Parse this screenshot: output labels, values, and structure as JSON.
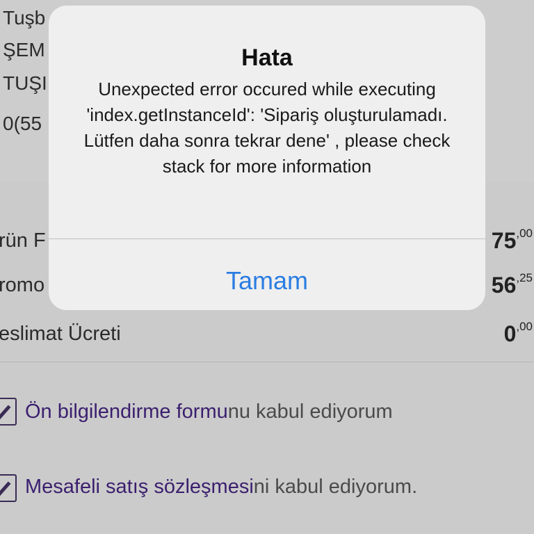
{
  "background": {
    "address_lines": [
      "Tuşb",
      "ŞEM",
      "TUŞI",
      "0(55"
    ],
    "summary": [
      {
        "label": "rün F",
        "amount_int": "75",
        "amount_dec": ",00"
      },
      {
        "label": "romo",
        "amount_int": "56",
        "amount_dec": ",25"
      },
      {
        "label": "eslimat Ücreti",
        "amount_int": "0",
        "amount_dec": ",00"
      }
    ],
    "agreements": [
      {
        "link": "Ön bilgilendirme formu",
        "rest": "nu kabul ediyorum"
      },
      {
        "link": "Mesafeli satış sözleşmesi",
        "rest": "ni kabul ediyorum."
      }
    ]
  },
  "alert": {
    "title": "Hata",
    "message": "Unexpected error occured while executing 'index.getInstanceId': 'Sipariş oluşturulamadı. Lütfen daha sonra tekrar dene' , please check stack for more information",
    "button_label": "Tamam"
  },
  "colors": {
    "link_purple": "#3b1f6e",
    "ios_blue": "#2a7de1"
  }
}
